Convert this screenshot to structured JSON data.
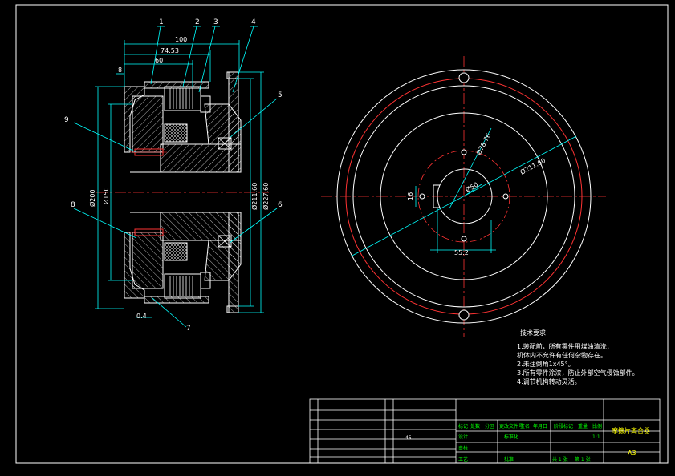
{
  "colors": {
    "background": "#000000",
    "frame": "#ffffff",
    "dimension": "#00ffff",
    "centerline": "#ff3333",
    "section": "#ffff00",
    "hatch": "#ffffff",
    "titleblock_text": "#00ff00"
  },
  "callouts": [
    "1",
    "2",
    "3",
    "4",
    "5",
    "6",
    "7",
    "8",
    "9"
  ],
  "section_dims": {
    "d100": "100",
    "d7453": "74.53",
    "d60": "60",
    "d8": "8",
    "phi200": "Ø200",
    "phi150": "Ø150",
    "phi21160": "Ø211.60",
    "phi22760": "Ø227.60",
    "d04": "0.4"
  },
  "plan_dims": {
    "phi7876": "Ø78.76",
    "phi21160": "Ø211.60",
    "phi50": "Ø50",
    "d16": "16",
    "d552": "55.2"
  },
  "notes": {
    "title": "技术要求",
    "lines": [
      "1.装配前，所有零件用煤油清洗，",
      "  机体内不允许有任何杂物存在。",
      "2.未注倒角1x45°。",
      "3.所有零件涂漆，防止外部空气侵蚀部件。",
      "4.调节机构转动灵活。"
    ]
  },
  "title_block": {
    "drawing_name": "摩擦片离合器",
    "scale_code": "A3",
    "cells": [
      "标记",
      "处数",
      "分区",
      "更改文件号",
      "签名",
      "年月日",
      "设计",
      "标准化",
      "审核",
      "工艺",
      "批准",
      "阶段标记",
      "重量",
      "比例",
      "1:1",
      "共 1 张",
      "第 1 张"
    ],
    "bom_small": "45"
  }
}
